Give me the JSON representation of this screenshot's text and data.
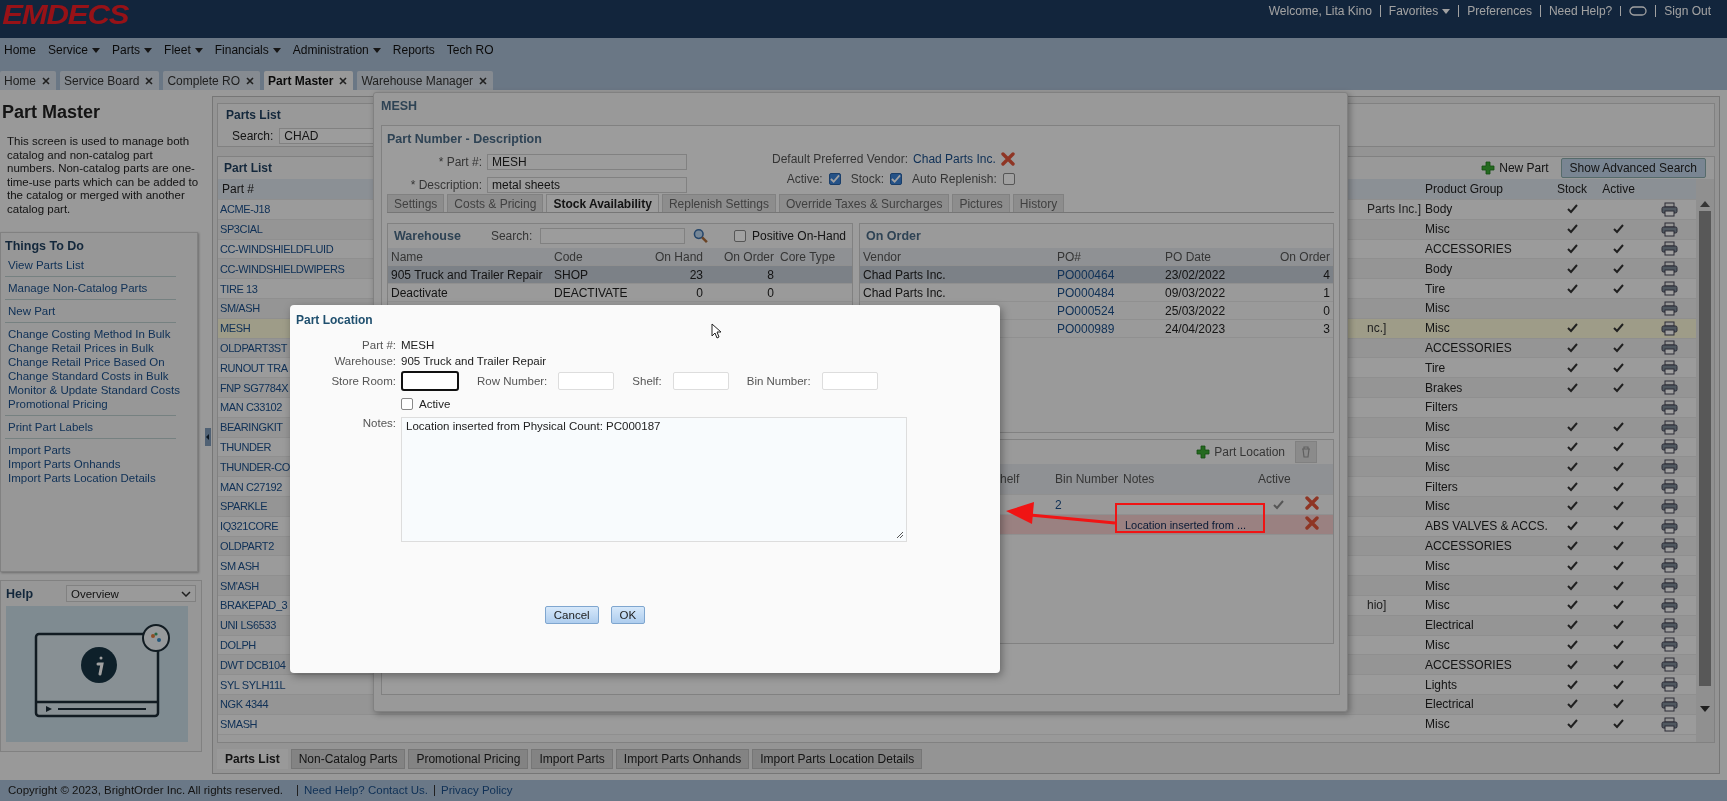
{
  "header": {
    "logo": "EMDECS",
    "links": [
      {
        "kind": "text",
        "label": "Welcome, Lita Kino"
      },
      {
        "kind": "menu",
        "label": "Favorites"
      },
      {
        "kind": "link",
        "label": "Preferences"
      },
      {
        "kind": "link",
        "label": "Need Help?"
      },
      {
        "kind": "chat"
      },
      {
        "kind": "link",
        "label": "Sign Out"
      }
    ]
  },
  "menu": [
    {
      "label": "Home",
      "dropdown": false
    },
    {
      "label": "Service",
      "dropdown": true
    },
    {
      "label": "Parts",
      "dropdown": true
    },
    {
      "label": "Fleet",
      "dropdown": true
    },
    {
      "label": "Financials",
      "dropdown": true
    },
    {
      "label": "Administration",
      "dropdown": true
    },
    {
      "label": "Reports",
      "dropdown": false
    },
    {
      "label": "Tech RO",
      "dropdown": false
    }
  ],
  "tabs": [
    {
      "label": "Home",
      "selected": false
    },
    {
      "label": "Service Board",
      "selected": false
    },
    {
      "label": "Complete RO",
      "selected": false
    },
    {
      "label": "Part Master",
      "selected": true
    },
    {
      "label": "Warehouse Manager",
      "selected": false
    }
  ],
  "sidebar": {
    "title": "Part Master",
    "description": "This screen is used to manage both catalog and non-catalog part numbers. Non-catalog parts are one-time-use parts which can be added to the catalog or merged with another catalog part.",
    "todo_title": "Things To Do",
    "todo_groups": [
      [
        "View Parts List"
      ],
      [
        "Manage Non-Catalog Parts"
      ],
      [
        "New Part"
      ],
      [
        "Change Costing Method In Bulk",
        "Change Retail Prices in Bulk",
        "Change Retail Price Based On",
        "Change Standard Costs in Bulk",
        "Monitor & Update Standard Costs",
        "Promotional Pricing"
      ],
      [
        "Print Part Labels"
      ],
      [
        "Import Parts",
        "Import Parts Onhands",
        "Import Parts Location Details"
      ]
    ],
    "help_title": "Help",
    "help_topic": "Overview"
  },
  "parts_list": {
    "title": "Parts List",
    "search_label": "Search:",
    "search_value": "CHAD",
    "grid_title": "Part List",
    "new_part": "New Part",
    "advanced_search": "Show Advanced Search",
    "columns": [
      "Part #",
      "Product Group",
      "Stock",
      "Active"
    ],
    "rows": [
      {
        "part": "ACME-J18",
        "column_3": "Parts Inc.]",
        "group": "Body",
        "stock": true,
        "active": false,
        "selected": false
      },
      {
        "part": "SP3CIAL",
        "group": "Misc",
        "stock": true,
        "active": true,
        "selected": false
      },
      {
        "part": "CC-WINDSHIELDFLUID",
        "group": "ACCESSORIES",
        "stock": true,
        "active": true,
        "selected": false
      },
      {
        "part": "CC-WINDSHIELDWIPERS",
        "group": "Body",
        "stock": true,
        "active": true,
        "selected": false
      },
      {
        "part": "TIRE 13",
        "group": "Tire",
        "stock": true,
        "active": true,
        "selected": false
      },
      {
        "part": "SM/ASH",
        "group": "Misc",
        "stock": false,
        "active": false,
        "selected": false
      },
      {
        "part": "MESH",
        "column_3": "nc.]",
        "group": "Misc",
        "stock": true,
        "active": true,
        "selected": true
      },
      {
        "part": "OLDPART3ST",
        "group": "ACCESSORIES",
        "stock": true,
        "active": true,
        "selected": false
      },
      {
        "part": "RUNOUT TRA",
        "group": "Tire",
        "stock": true,
        "active": true,
        "selected": false
      },
      {
        "part": "FNP SG7784X",
        "group": "Brakes",
        "stock": true,
        "active": true,
        "selected": false
      },
      {
        "part": "MAN C33102",
        "group": "Filters",
        "stock": false,
        "active": false,
        "selected": false
      },
      {
        "part": "BEARINGKIT",
        "group": "Misc",
        "stock": true,
        "active": true,
        "selected": false
      },
      {
        "part": "THUNDER",
        "group": "Misc",
        "stock": true,
        "active": true,
        "selected": false
      },
      {
        "part": "THUNDER-CO",
        "group": "Misc",
        "stock": true,
        "active": true,
        "selected": false
      },
      {
        "part": "MAN C27192",
        "group": "Filters",
        "stock": true,
        "active": true,
        "selected": false
      },
      {
        "part": "SPARKLE",
        "group": "Misc",
        "stock": true,
        "active": true,
        "selected": false
      },
      {
        "part": "IQ321CORE",
        "group": "ABS VALVES & ACCS.",
        "stock": true,
        "active": true,
        "selected": false
      },
      {
        "part": "OLDPART2",
        "group": "ACCESSORIES",
        "stock": true,
        "active": true,
        "selected": false
      },
      {
        "part": "SM ASH",
        "group": "Misc",
        "stock": true,
        "active": true,
        "selected": false
      },
      {
        "part": "SM'ASH",
        "group": "Misc",
        "stock": true,
        "active": true,
        "selected": false
      },
      {
        "part": "BRAKEPAD_3",
        "column_3": "hio]",
        "group": "Misc",
        "stock": true,
        "active": true,
        "selected": false
      },
      {
        "part": "UNI LS6533",
        "group": "Electrical",
        "stock": true,
        "active": true,
        "selected": false
      },
      {
        "part": "DOLPH",
        "group": "Misc",
        "stock": true,
        "active": true,
        "selected": false
      },
      {
        "part": "DWT DCB104",
        "group": "ACCESSORIES",
        "stock": true,
        "active": true,
        "selected": false
      },
      {
        "part": "SYL SYLH11L",
        "group": "Lights",
        "stock": true,
        "active": true,
        "selected": false
      },
      {
        "part": "NGK 4344",
        "group": "Electrical",
        "stock": true,
        "active": true,
        "selected": false
      },
      {
        "part": "SMASH",
        "group": "Misc",
        "stock": true,
        "active": true,
        "selected": false
      }
    ]
  },
  "bottom_tabs": [
    {
      "label": "Parts List",
      "selected": true
    },
    {
      "label": "Non-Catalog Parts",
      "selected": false
    },
    {
      "label": "Promotional Pricing",
      "selected": false
    },
    {
      "label": "Import Parts",
      "selected": false
    },
    {
      "label": "Import Parts Onhands",
      "selected": false
    },
    {
      "label": "Import Parts Location Details",
      "selected": false
    }
  ],
  "footer": {
    "copyright": "Copyright © 2023, BrightOrder Inc. All rights reserved.",
    "links": [
      "Need Help? Contact Us.",
      "Privacy Policy"
    ]
  },
  "part_dialog": {
    "title": "MESH",
    "section": "Part Number - Description",
    "fields": [
      {
        "label": "* Part #:",
        "value": "MESH"
      },
      {
        "label": "* Description:",
        "value": "metal sheets"
      }
    ],
    "vendor_label": "Default Preferred Vendor:",
    "vendor": "Chad Parts Inc.",
    "flags": [
      {
        "label": "Active:",
        "checked": true
      },
      {
        "label": "Stock:",
        "checked": true
      },
      {
        "label": "Auto Replenish:",
        "checked": false
      }
    ],
    "tabs": [
      {
        "label": "Settings",
        "selected": false
      },
      {
        "label": "Costs & Pricing",
        "selected": false
      },
      {
        "label": "Stock Availability",
        "selected": true
      },
      {
        "label": "Replenish Settings",
        "selected": false
      },
      {
        "label": "Override Taxes & Surcharges",
        "selected": false
      },
      {
        "label": "Pictures",
        "selected": false
      },
      {
        "label": "History",
        "selected": false
      }
    ],
    "warehouse": {
      "title": "Warehouse",
      "search_label": "Search:",
      "filter": {
        "label": "Positive On-Hand",
        "checked": false
      },
      "columns": [
        "Name",
        "Code",
        "On Hand",
        "On Order",
        "Core Type"
      ],
      "rows": [
        {
          "name": "905 Truck and Trailer Repair",
          "code": "SHOP",
          "on_hand": "23",
          "on_order": "8",
          "selected": true
        },
        {
          "name": "Deactivate",
          "code": "DEACTIVATE",
          "on_hand": "0",
          "on_order": "0",
          "selected": false
        }
      ]
    },
    "on_order": {
      "title": "On Order",
      "columns": [
        "Vendor",
        "PO#",
        "PO Date",
        "On Order"
      ],
      "rows": [
        {
          "vendor": "Chad Parts Inc.",
          "po": "PO000464",
          "date": "23/02/2022",
          "qty": "4",
          "selected": true
        },
        {
          "vendor": "Chad Parts Inc.",
          "po": "PO000484",
          "date": "09/03/2022",
          "qty": "1",
          "selected": false
        },
        {
          "po": "PO000524",
          "date": "25/03/2022",
          "qty": "0",
          "selected": false
        },
        {
          "po": "PO000989",
          "date": "24/04/2023",
          "qty": "3",
          "selected": false
        }
      ]
    },
    "locations": {
      "add_label": "Part Location",
      "columns": [
        "helf",
        "Bin Number",
        "Notes",
        "Active"
      ],
      "rows": [
        {
          "bin": "2",
          "active": true,
          "selected": false
        },
        {
          "notes": "Location inserted from ...",
          "active": false,
          "selected": true
        }
      ]
    }
  },
  "location_dialog": {
    "title": "Part Location",
    "part_label": "Part #:",
    "part": "MESH",
    "warehouse_label": "Warehouse:",
    "warehouse": "905 Truck and Trailer Repair",
    "inputs": [
      {
        "label": "Store Room:",
        "focused": true
      },
      {
        "label": "Row Number:",
        "focused": false
      },
      {
        "label": "Shelf:",
        "focused": false
      },
      {
        "label": "Bin Number:",
        "focused": false
      }
    ],
    "active": {
      "label": "Active",
      "checked": false
    },
    "notes_label": "Notes:",
    "notes": "Location inserted from Physical Count: PC000187",
    "buttons": [
      "Cancel",
      "OK"
    ]
  }
}
